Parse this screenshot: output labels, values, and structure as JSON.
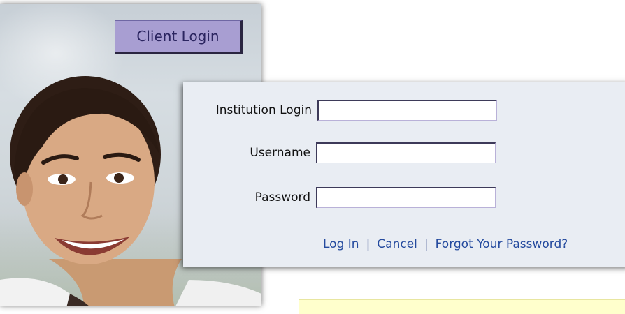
{
  "client_login": {
    "label": "Client Login"
  },
  "login_form": {
    "institution_label": "Institution Login",
    "institution_value": "",
    "username_label": "Username",
    "username_value": "",
    "password_label": "Password",
    "password_value": ""
  },
  "links": {
    "login": "Log In",
    "cancel": "Cancel",
    "forgot": "Forgot Your Password?",
    "separator": "|"
  },
  "colors": {
    "button_fill": "#a89ed2",
    "panel_bg": "#e9edf3",
    "link": "#244a9e",
    "notice_bar": "#ffffcc"
  }
}
